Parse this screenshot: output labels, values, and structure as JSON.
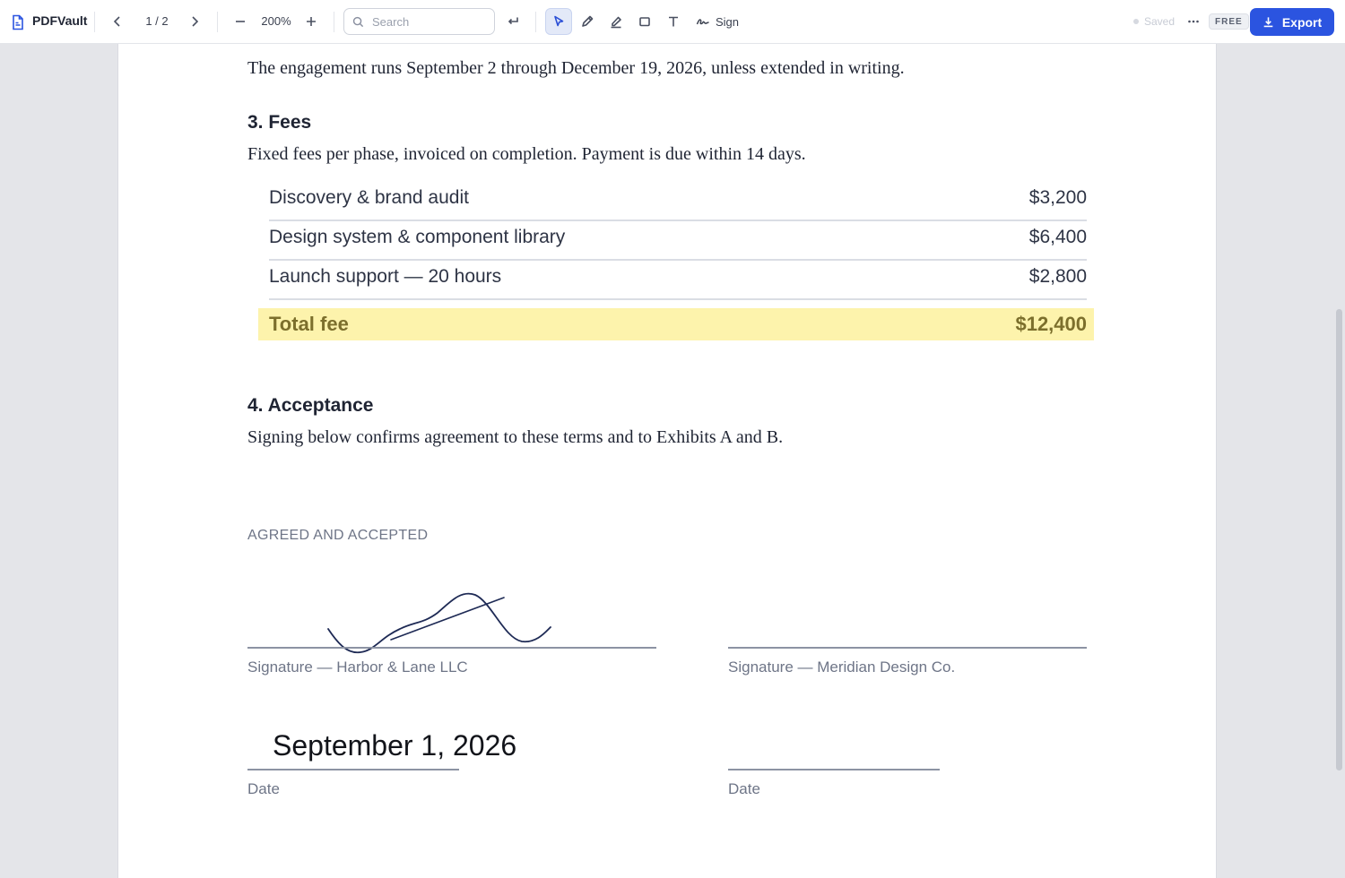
{
  "app": {
    "name": "PDFVault"
  },
  "toolbar": {
    "page_indicator": "1 / 2",
    "zoom": "200%",
    "search_placeholder": "Search",
    "sign_label": "Sign",
    "saved_label": "Saved",
    "plan_badge": "FREE",
    "export_label": "Export",
    "active_tool": "select"
  },
  "document": {
    "intro_line": "The engagement runs September 2 through December 19, 2026, unless extended in writing.",
    "fees": {
      "heading": "3. Fees",
      "description": "Fixed fees per phase, invoiced on completion. Payment is due within 14 days.",
      "items": [
        {
          "label": "Discovery & brand audit",
          "amount": "$3,200"
        },
        {
          "label": "Design system & component library",
          "amount": "$6,400"
        },
        {
          "label": "Launch support — 20 hours",
          "amount": "$2,800"
        }
      ],
      "total_label": "Total fee",
      "total_amount": "$12,400"
    },
    "acceptance": {
      "heading": "4. Acceptance",
      "text": "Signing below confirms agreement to these terms and to Exhibits A and B."
    },
    "signatures": {
      "header": "AGREED AND ACCEPTED",
      "left_label": "Signature — Harbor & Lane LLC",
      "right_label": "Signature — Meridian Design Co.",
      "left_date": "September 1, 2026",
      "date_label": "Date"
    }
  },
  "colors": {
    "accent": "#2b54e0",
    "highlight": "#fdf3ac",
    "signature_ink": "#1e2a55"
  }
}
